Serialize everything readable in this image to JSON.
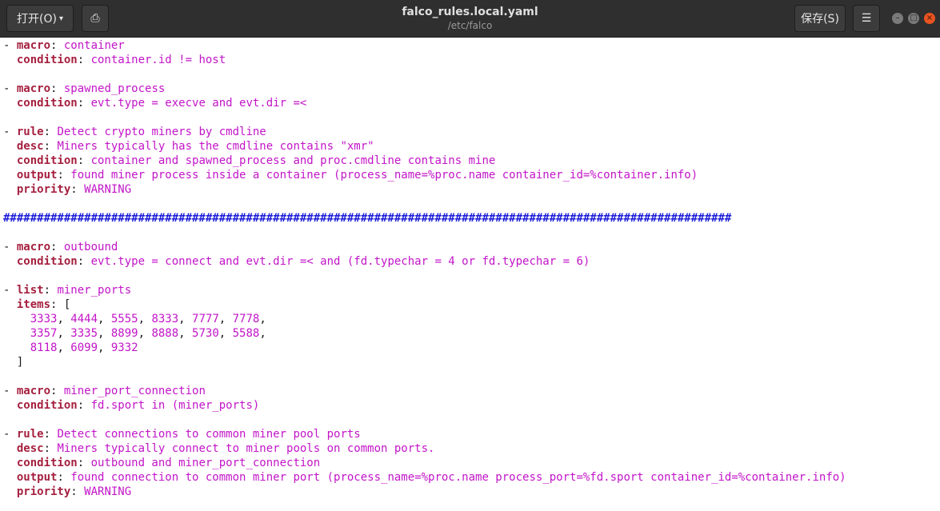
{
  "header": {
    "open_label": "打开(O)",
    "open_caret": "▾",
    "pin_icon_glyph": "⎙",
    "title": "falco_rules.local.yaml",
    "subtitle": "/etc/falco",
    "save_label": "保存(S)",
    "menu_icon_glyph": "☰",
    "minimize_glyph": "–",
    "maximize_glyph": "□",
    "close_glyph": "×",
    "colors": {
      "titlebar": "#2f2f2f",
      "close_accent": "#e95420"
    }
  },
  "icons": [
    "document-pin-icon",
    "hamburger-menu-icon",
    "minimize-icon",
    "maximize-icon",
    "close-icon",
    "chevron-down-icon"
  ],
  "editor": {
    "colors": {
      "key": "#a5203f",
      "value": "#c215c8",
      "comment": "#1b1bd8",
      "text": "#1a1a1a"
    },
    "lines": [
      {
        "segs": [
          [
            "p",
            "- "
          ],
          [
            "k",
            "macro"
          ],
          [
            "p",
            ": "
          ],
          [
            "v",
            "container"
          ]
        ]
      },
      {
        "segs": [
          [
            "p",
            "  "
          ],
          [
            "k",
            "condition"
          ],
          [
            "p",
            ": "
          ],
          [
            "v",
            "container.id != host"
          ]
        ]
      },
      {
        "segs": []
      },
      {
        "segs": [
          [
            "p",
            "- "
          ],
          [
            "k",
            "macro"
          ],
          [
            "p",
            ": "
          ],
          [
            "v",
            "spawned_process"
          ]
        ]
      },
      {
        "segs": [
          [
            "p",
            "  "
          ],
          [
            "k",
            "condition"
          ],
          [
            "p",
            ": "
          ],
          [
            "v",
            "evt.type = execve and evt.dir =<"
          ]
        ]
      },
      {
        "segs": []
      },
      {
        "segs": [
          [
            "p",
            "- "
          ],
          [
            "k",
            "rule"
          ],
          [
            "p",
            ": "
          ],
          [
            "v",
            "Detect crypto miners by cmdline"
          ]
        ]
      },
      {
        "segs": [
          [
            "p",
            "  "
          ],
          [
            "k",
            "desc"
          ],
          [
            "p",
            ": "
          ],
          [
            "v",
            "Miners typically has the cmdline contains \"xmr\""
          ]
        ]
      },
      {
        "segs": [
          [
            "p",
            "  "
          ],
          [
            "k",
            "condition"
          ],
          [
            "p",
            ": "
          ],
          [
            "v",
            "container and spawned_process and proc.cmdline contains mine"
          ]
        ]
      },
      {
        "segs": [
          [
            "p",
            "  "
          ],
          [
            "k",
            "output"
          ],
          [
            "p",
            ": "
          ],
          [
            "v",
            "found miner process inside a container (process_name=%proc.name container_id=%container.info)"
          ]
        ]
      },
      {
        "segs": [
          [
            "p",
            "  "
          ],
          [
            "k",
            "priority"
          ],
          [
            "p",
            ": "
          ],
          [
            "v",
            "WARNING"
          ]
        ]
      },
      {
        "segs": []
      },
      {
        "segs": [
          [
            "c",
            "############################################################################################################"
          ]
        ]
      },
      {
        "segs": []
      },
      {
        "segs": [
          [
            "p",
            "- "
          ],
          [
            "k",
            "macro"
          ],
          [
            "p",
            ": "
          ],
          [
            "v",
            "outbound"
          ]
        ]
      },
      {
        "segs": [
          [
            "p",
            "  "
          ],
          [
            "k",
            "condition"
          ],
          [
            "p",
            ": "
          ],
          [
            "v",
            "evt.type = connect and evt.dir =< and (fd.typechar = 4 or fd.typechar = 6)"
          ]
        ]
      },
      {
        "segs": []
      },
      {
        "segs": [
          [
            "p",
            "- "
          ],
          [
            "k",
            "list"
          ],
          [
            "p",
            ": "
          ],
          [
            "v",
            "miner_ports"
          ]
        ]
      },
      {
        "segs": [
          [
            "p",
            "  "
          ],
          [
            "k",
            "items"
          ],
          [
            "p",
            ": ["
          ]
        ]
      },
      {
        "segs": [
          [
            "p",
            "    "
          ],
          [
            "v",
            "3333"
          ],
          [
            "p",
            ", "
          ],
          [
            "v",
            "4444"
          ],
          [
            "p",
            ", "
          ],
          [
            "v",
            "5555"
          ],
          [
            "p",
            ", "
          ],
          [
            "v",
            "8333"
          ],
          [
            "p",
            ", "
          ],
          [
            "v",
            "7777"
          ],
          [
            "p",
            ", "
          ],
          [
            "v",
            "7778"
          ],
          [
            "p",
            ","
          ]
        ]
      },
      {
        "segs": [
          [
            "p",
            "    "
          ],
          [
            "v",
            "3357"
          ],
          [
            "p",
            ", "
          ],
          [
            "v",
            "3335"
          ],
          [
            "p",
            ", "
          ],
          [
            "v",
            "8899"
          ],
          [
            "p",
            ", "
          ],
          [
            "v",
            "8888"
          ],
          [
            "p",
            ", "
          ],
          [
            "v",
            "5730"
          ],
          [
            "p",
            ", "
          ],
          [
            "v",
            "5588"
          ],
          [
            "p",
            ","
          ]
        ]
      },
      {
        "segs": [
          [
            "p",
            "    "
          ],
          [
            "v",
            "8118"
          ],
          [
            "p",
            ", "
          ],
          [
            "v",
            "6099"
          ],
          [
            "p",
            ", "
          ],
          [
            "v",
            "9332"
          ]
        ]
      },
      {
        "segs": [
          [
            "p",
            "  ]"
          ]
        ]
      },
      {
        "segs": []
      },
      {
        "segs": [
          [
            "p",
            "- "
          ],
          [
            "k",
            "macro"
          ],
          [
            "p",
            ": "
          ],
          [
            "v",
            "miner_port_connection"
          ]
        ]
      },
      {
        "segs": [
          [
            "p",
            "  "
          ],
          [
            "k",
            "condition"
          ],
          [
            "p",
            ": "
          ],
          [
            "v",
            "fd.sport in (miner_ports)"
          ]
        ]
      },
      {
        "segs": []
      },
      {
        "segs": [
          [
            "p",
            "- "
          ],
          [
            "k",
            "rule"
          ],
          [
            "p",
            ": "
          ],
          [
            "v",
            "Detect connections to common miner pool ports"
          ]
        ]
      },
      {
        "segs": [
          [
            "p",
            "  "
          ],
          [
            "k",
            "desc"
          ],
          [
            "p",
            ": "
          ],
          [
            "v",
            "Miners typically connect to miner pools on common ports."
          ]
        ]
      },
      {
        "segs": [
          [
            "p",
            "  "
          ],
          [
            "k",
            "condition"
          ],
          [
            "p",
            ": "
          ],
          [
            "v",
            "outbound and miner_port_connection"
          ]
        ]
      },
      {
        "segs": [
          [
            "p",
            "  "
          ],
          [
            "k",
            "output"
          ],
          [
            "p",
            ": "
          ],
          [
            "v",
            "found connection to common miner port (process_name=%proc.name process_port=%fd.sport container_id=%container.info)"
          ]
        ]
      },
      {
        "segs": [
          [
            "p",
            "  "
          ],
          [
            "k",
            "priority"
          ],
          [
            "p",
            ": "
          ],
          [
            "v",
            "WARNING"
          ]
        ]
      }
    ]
  }
}
